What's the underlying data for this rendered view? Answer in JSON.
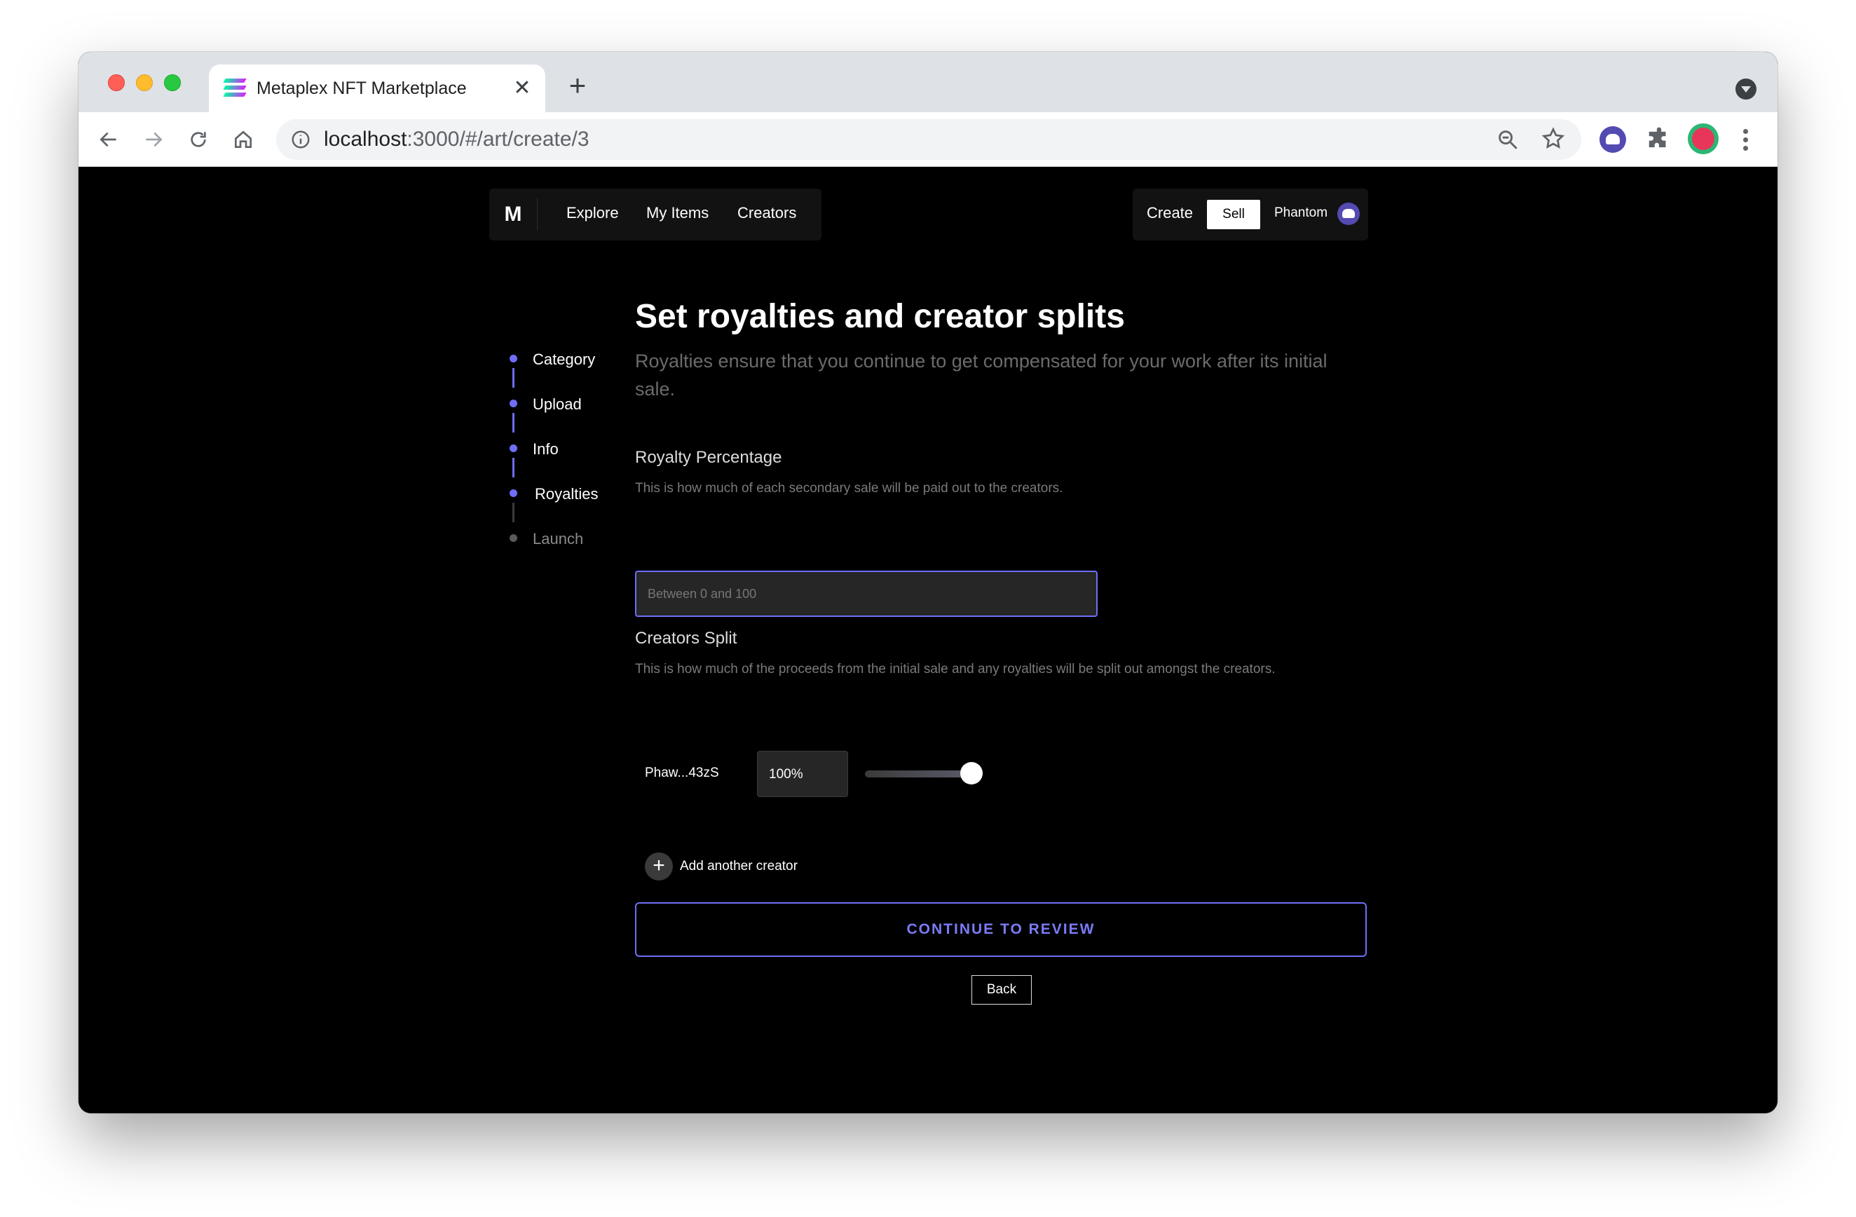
{
  "browser": {
    "tab_title": "Metaplex NFT Marketplace",
    "url_host": "localhost",
    "url_path": ":3000/#/art/create/3",
    "new_tab_symbol": "+",
    "tab_close_symbol": "✕"
  },
  "nav": {
    "logo": "M",
    "links": [
      "Explore",
      "My Items",
      "Creators"
    ],
    "create": "Create",
    "sell": "Sell",
    "wallet": "Phantom"
  },
  "steps": [
    {
      "label": "Category",
      "state": "done"
    },
    {
      "label": "Upload",
      "state": "done"
    },
    {
      "label": "Info",
      "state": "done"
    },
    {
      "label": "Royalties",
      "state": "current"
    },
    {
      "label": "Launch",
      "state": "pending"
    }
  ],
  "main": {
    "title": "Set royalties and creator splits",
    "subtitle": "Royalties ensure that you continue to get compensated for your work after its initial sale.",
    "royalty": {
      "title": "Royalty Percentage",
      "description": "This is how much of each secondary sale will be paid out to the creators.",
      "placeholder": "Between 0 and 100",
      "value": ""
    },
    "split": {
      "title": "Creators Split",
      "description": "This is how much of the proceeds from the initial sale and any royalties will be split out amongst the creators.",
      "creators": [
        {
          "name": "Phaw...43zS",
          "share": "100%",
          "share_fraction": 1.0
        }
      ],
      "add_symbol": "+",
      "add_label": "Add another creator"
    },
    "continue_label": "CONTINUE TO REVIEW",
    "back_label": "Back"
  },
  "colors": {
    "accent": "#6e6ef7",
    "page_bg": "#000000",
    "panel_bg": "#121212",
    "input_bg": "#262626"
  },
  "icons": [
    "back-arrow-icon",
    "forward-arrow-icon",
    "reload-icon",
    "home-icon",
    "info-icon",
    "zoom-icon",
    "star-icon",
    "phantom-extension-icon",
    "puzzle-icon",
    "profile-avatar",
    "kebab-menu-icon",
    "plus-icon"
  ]
}
